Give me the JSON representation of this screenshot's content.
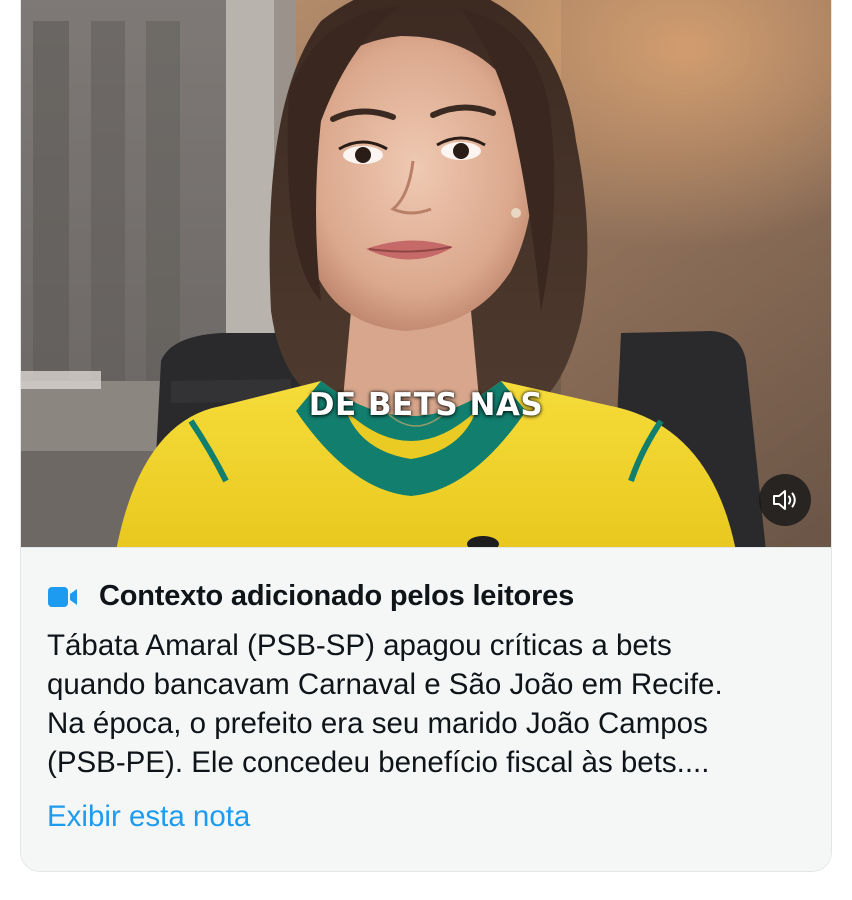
{
  "video": {
    "caption": "DE BETS NAS",
    "sound_icon": "speaker-volume-icon"
  },
  "note": {
    "icon": "video-camera-icon",
    "title": "Contexto adicionado pelos leitores",
    "lines": [
      "Tábata Amaral (PSB-SP) apagou críticas a bets",
      "quando bancavam Carnaval e São João em Recife.",
      "Na época, o prefeito era seu marido João Campos",
      "(PSB-PE). Ele concedeu benefício fiscal às bets...."
    ],
    "link": "Exibir esta nota"
  },
  "colors": {
    "note_background": "#f5f7f7",
    "link": "#1d9bf0",
    "icon_blue": "#1d9bf0",
    "text": "#0f1419",
    "jersey_yellow": "#f2d52a",
    "jersey_green": "#0f7d6e"
  }
}
